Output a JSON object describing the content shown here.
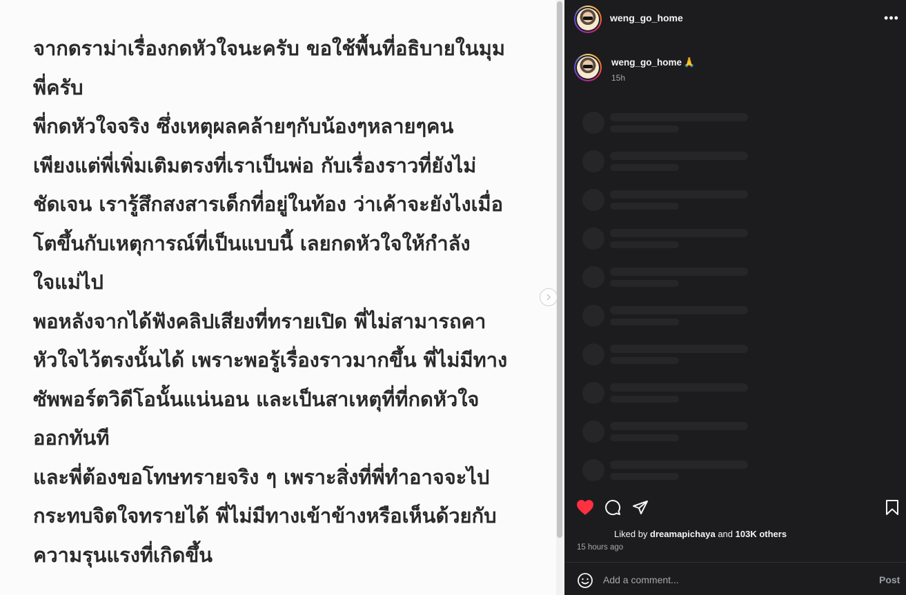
{
  "image_post": {
    "lines": [
      "จากดราม่าเรื่องกดหัวใจนะครับ ขอใช้พื้นที่อธิบายในมุม",
      "พี่ครับ",
      "พี่กดหัวใจจริง ซึ่งเหตุผลคล้ายๆกับน้องๆหลายๆคน",
      "เพียงแต่พี่เพิ่มเติมตรงที่เราเป็นพ่อ กับเรื่องราวที่ยังไม่",
      "ชัดเจน เรารู้สึกสงสารเด็กที่อยู่ในท้อง ว่าเค้าจะยังไงเมื่อ",
      "โตขึ้นกับเหตุการณ์ที่เป็นแบบนี้ เลยกดหัวใจให้กำลัง",
      "ใจแม่ไป",
      "พอหลังจากได้ฟังคลิปเสียงที่ทรายเปิด พี่ไม่สามารถคา",
      "หัวใจไว้ตรงนั้นได้ เพราะพอรู้เรื่องราวมากขึ้น พี่ไม่มีทาง",
      "ซัพพอร์ตวิดีโอนั้นแน่นอน และเป็นสาเหตุที่ที่กดหัวใจ",
      "ออกทันที",
      "และพี่ต้องขอโทษทรายจริง ๆ เพราะสิ่งที่พี่ทำอาจจะไป",
      "กระทบจิตใจทรายได้ พี่ไม่มีทางเข้าข้างหรือเห็นด้วยกับ",
      "ความรุนแรงที่เกิดขึ้น"
    ]
  },
  "header": {
    "username": "weng_go_home",
    "more_icon": "more-horizontal-icon",
    "more_glyph": "•••"
  },
  "caption": {
    "username": "weng_go_home",
    "emoji": "🙏",
    "time": "15h"
  },
  "actions": {
    "like_icon": "heart-filled-icon",
    "comment_icon": "comment-icon",
    "share_icon": "share-icon",
    "save_icon": "bookmark-icon",
    "like_color": "#ff3040"
  },
  "likes": {
    "prefix": "Liked by ",
    "user": "dreamapichaya",
    "middle": " and ",
    "count": "103K others"
  },
  "post_time": "15 hours ago",
  "comment": {
    "placeholder": "Add a comment...",
    "post_label": "Post"
  }
}
